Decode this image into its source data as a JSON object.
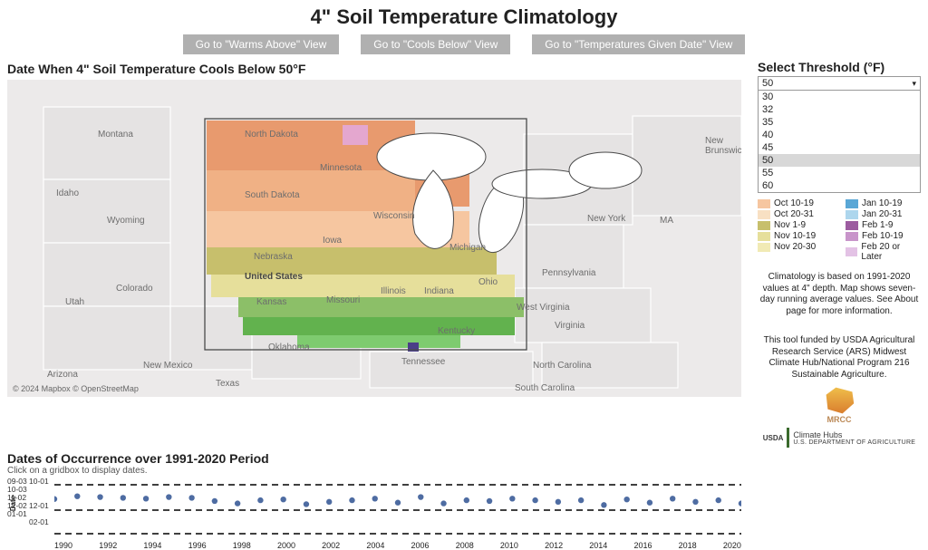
{
  "title": "4\" Soil Temperature Climatology",
  "nav": {
    "warms": "Go to \"Warms Above\" View",
    "cools": "Go to \"Cools Below\" View",
    "given": "Go to \"Temperatures Given Date\" View"
  },
  "subtitle": "Date When 4\" Soil Temperature Cools Below 50°F",
  "map": {
    "attrib": "© 2024 Mapbox  © OpenStreetMap",
    "labels": {
      "nd": "North Dakota",
      "sd": "South Dakota",
      "mn": "Minnesota",
      "ia": "Iowa",
      "wi": "Wisconsin",
      "mi": "Michigan",
      "il": "Illinois",
      "in": "Indiana",
      "oh": "Ohio",
      "ky": "Kentucky",
      "mo": "Missouri",
      "ne": "Nebraska",
      "ks": "Kansas",
      "ok": "Oklahoma",
      "tx": "Texas",
      "tn": "Tennessee",
      "wv": "West Virginia",
      "va": "Virginia",
      "pa": "Pennsylvania",
      "ny": "New York",
      "us": "United States",
      "wy": "Wyoming",
      "co": "Colorado",
      "ut": "Utah",
      "id": "Idaho",
      "mt": "Montana",
      "nm": "New Mexico",
      "az": "Arizona",
      "nc": "North Carolina",
      "sc": "South Carolina",
      "ma": "MA",
      "nb": "New Brunswick"
    }
  },
  "select": {
    "title": "Select Threshold (°F)",
    "current": "50",
    "options": [
      "30",
      "32",
      "35",
      "40",
      "45",
      "50",
      "55",
      "60"
    ]
  },
  "legend": {
    "left": [
      {
        "label": "Oct 10-19",
        "color": "#f6c6a0"
      },
      {
        "label": "Oct 20-31",
        "color": "#f8e0c3"
      },
      {
        "label": "Nov 1-9",
        "color": "#c7bf6c"
      },
      {
        "label": "Nov 10-19",
        "color": "#e6df9b"
      },
      {
        "label": "Nov 20-30",
        "color": "#f1eab5"
      }
    ],
    "right": [
      {
        "label": "Jan 10-19",
        "color": "#5aa7d6"
      },
      {
        "label": "Jan 20-31",
        "color": "#add6ed"
      },
      {
        "label": "Feb 1-9",
        "color": "#9c5ca0"
      },
      {
        "label": "Feb 10-19",
        "color": "#c894ca"
      },
      {
        "label": "Feb 20 or Later",
        "color": "#e3c2e5"
      }
    ]
  },
  "climate_note": "Climatology is based on 1991-2020 values at 4\" depth.  Map shows seven-day running average values.  See About page for more information.",
  "funding_note": "This tool funded by USDA Agricultural Research Service (ARS) Midwest Climate Hub/National Program 216 Sustainable Agriculture.",
  "logos": {
    "mrcc": "MRCC",
    "ch_top": "Climate Hubs",
    "ch_bottom": "U.S. DEPARTMENT OF AGRICULTURE",
    "usda": "USDA"
  },
  "bottom": {
    "title": "Dates of Occurrence over 1991-2020 Period",
    "hint": "Click on a gridbox to display dates.",
    "yleft": [
      "09-03",
      "10-03",
      "11-02",
      "12-02",
      "01-01"
    ],
    "yleft2": [
      "10-01",
      "",
      "",
      "12-01",
      "",
      "02-01"
    ],
    "axis_label": "Date"
  },
  "chart_data": {
    "type": "scatter",
    "title": "Dates of Occurrence over 1991-2020 Period",
    "xlabel": "",
    "ylabel": "Date",
    "ylim": [
      "09-03",
      "02-01"
    ],
    "y_gridlines": [
      "10-01",
      "12-01",
      "02-01"
    ],
    "x": [
      1990,
      1991,
      1992,
      1993,
      1994,
      1995,
      1996,
      1997,
      1998,
      1999,
      2000,
      2001,
      2002,
      2003,
      2004,
      2005,
      2006,
      2007,
      2008,
      2009,
      2010,
      2011,
      2012,
      2013,
      2014,
      2015,
      2016,
      2017,
      2018,
      2019,
      2020
    ],
    "y": [
      "10-25",
      "10-18",
      "10-20",
      "10-22",
      "10-24",
      "10-20",
      "10-22",
      "10-30",
      "11-06",
      "10-28",
      "10-26",
      "11-08",
      "11-02",
      "10-28",
      "10-24",
      "11-04",
      "10-20",
      "11-06",
      "10-28",
      "10-30",
      "10-24",
      "10-28",
      "11-02",
      "10-28",
      "11-10",
      "10-26",
      "11-04",
      "10-24",
      "11-02",
      "10-28",
      "11-06"
    ],
    "x_ticks": [
      1990,
      1992,
      1994,
      1996,
      1998,
      2000,
      2002,
      2004,
      2006,
      2008,
      2010,
      2012,
      2014,
      2016,
      2018,
      2020
    ]
  }
}
